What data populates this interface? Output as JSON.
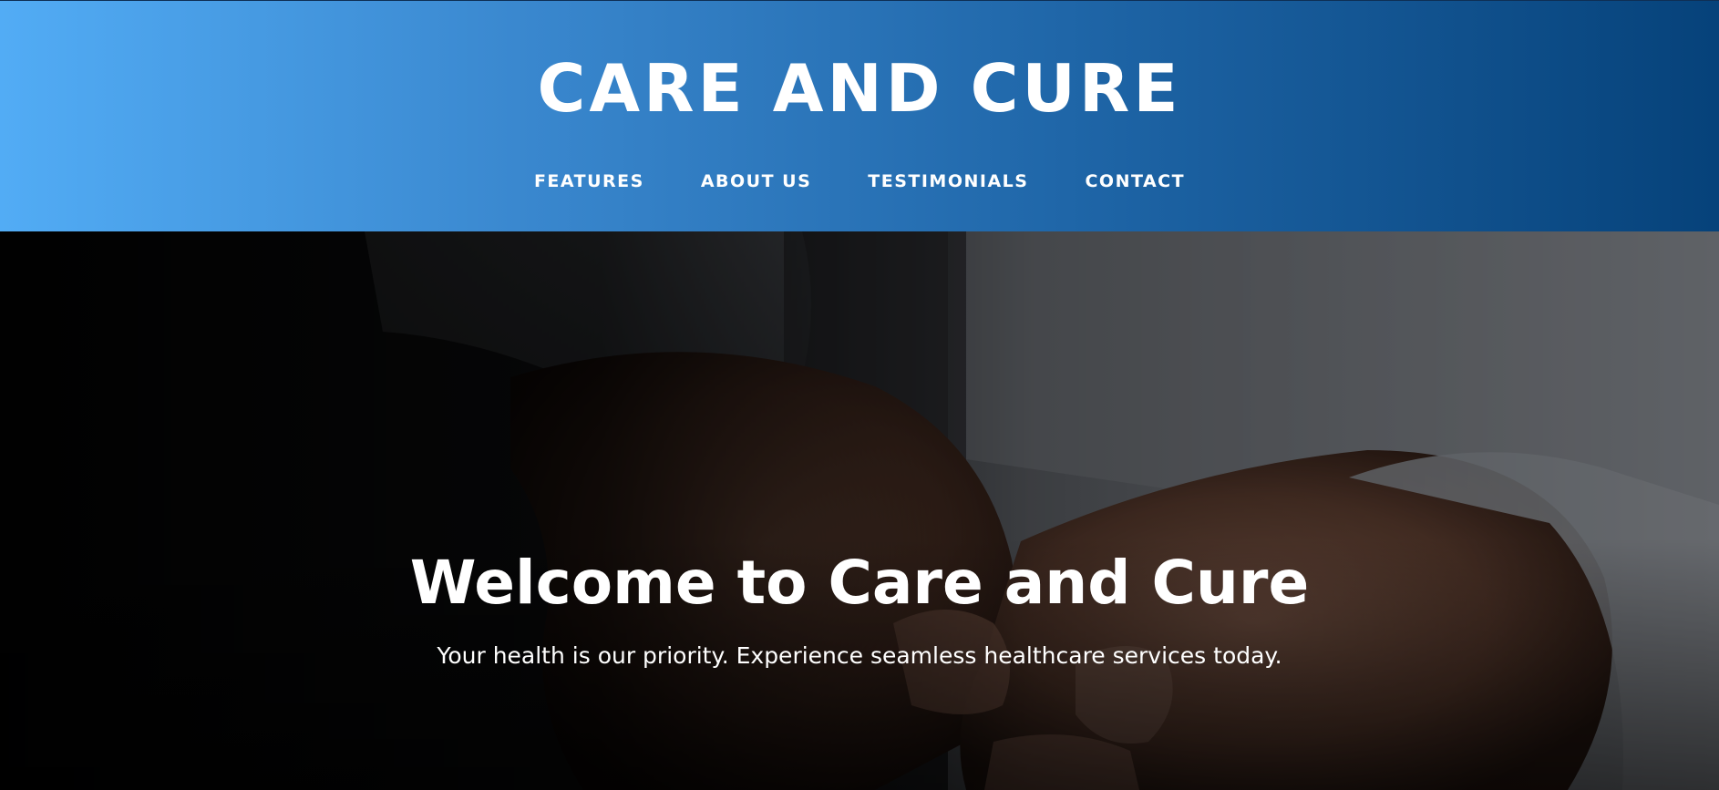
{
  "header": {
    "brand": "CARE AND CURE",
    "nav": [
      {
        "label": "FEATURES"
      },
      {
        "label": "ABOUT US"
      },
      {
        "label": "TESTIMONIALS"
      },
      {
        "label": "CONTACT"
      }
    ]
  },
  "hero": {
    "title": "Welcome to Care and Cure",
    "subtitle": "Your health is our priority. Experience seamless healthcare services today.",
    "image": "hands-holding-photo"
  },
  "colors": {
    "header_gradient_start": "#52acf5",
    "header_gradient_end": "#06427a",
    "text": "#ffffff"
  }
}
